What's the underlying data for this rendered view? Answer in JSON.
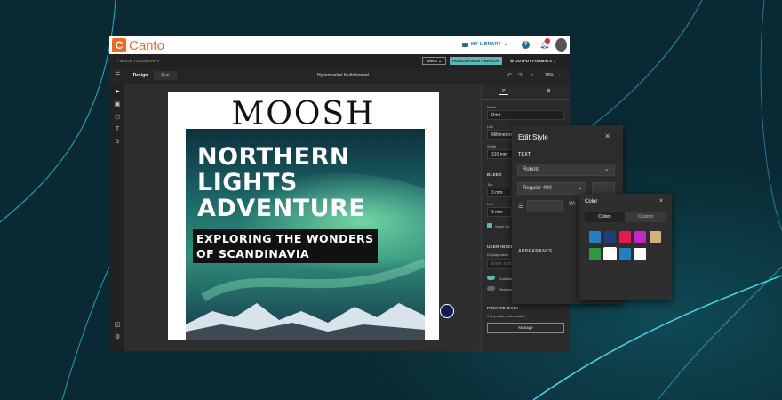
{
  "app": {
    "brand": "Canto",
    "logo_letter": "C"
  },
  "topbar": {
    "my_library": "MY LIBRARY",
    "help_icon": "?",
    "notification_count": ""
  },
  "subbar": {
    "back": "‹ BACK TO LIBRARY",
    "save": "SAVE ⌄",
    "publish": "PUBLISH NEW VERSION",
    "output_formats": "⚙ OUTPUT FORMATS ⌄"
  },
  "toolbar": {
    "tabs": [
      "Design",
      "Run"
    ],
    "doc_title": "Hypermarket Multichannel",
    "zoom": "28%"
  },
  "document": {
    "brand_title": "MOOSH",
    "headline_lines": [
      "NORTHERN",
      "LIGHTS",
      "ADVENTURE"
    ],
    "sub_lines": [
      "EXPLORING THE WONDERS",
      "OF SCANDINAVIA"
    ]
  },
  "right_panel": {
    "intent_label": "Intent",
    "intent_value": "Print",
    "unit_label": "Unit",
    "unit_value": "Millimeters",
    "width_label": "Width",
    "width_value": "310 mm",
    "bleed_section": "BLEED",
    "top_label": "Top",
    "top_value": "3 mm",
    "left_label": "Left",
    "left_value": "3 mm",
    "same_for_label": "Same for",
    "user_interface_section": "USER INTERF",
    "display_name_label": "Display name",
    "display_name_placeholder": "Enter a display name",
    "available_label": "Available",
    "restricted_label": "Restricted",
    "private_data_section": "PRIVATE DATA",
    "private_data_note": "0 key-value pairs added",
    "manage_button": "Manage"
  },
  "edit_style": {
    "title": "Edit Style",
    "text_section": "TEXT",
    "font_family": "Roboto",
    "font_weight": "Regular 400",
    "appearance_section": "APPEARANCE"
  },
  "color_popover": {
    "title": "Color",
    "tabs": [
      "Colors",
      "Custom"
    ],
    "swatches": [
      "#1f7fc7",
      "#1d3f7a",
      "#e8194d",
      "#c626c6",
      "#d4b07a",
      "#2e9a3e",
      "#ffffff",
      "#1f7fc7",
      "#ffffff"
    ],
    "selected_index": 6
  },
  "colors": {
    "accent": "#f26a21",
    "teal": "#5fb6b6",
    "background": "#0a2a33"
  }
}
